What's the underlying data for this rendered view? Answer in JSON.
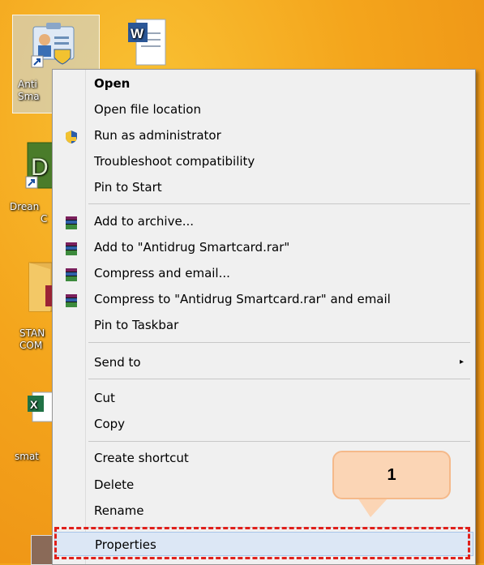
{
  "desktop": {
    "icons": [
      {
        "label_line1": "Anti",
        "label_line2": "Sma"
      },
      {
        "label_line1": "",
        "label_line2": ""
      },
      {
        "label_line1": "Drean",
        "label_line2": "C"
      },
      {
        "label_line1": "STAN",
        "label_line2": "COM"
      },
      {
        "label_line1": "smat",
        "label_line2": ""
      }
    ]
  },
  "menu": {
    "items": [
      {
        "label": "Open"
      },
      {
        "label": "Open file location"
      },
      {
        "label": "Run as administrator",
        "icon": "uac-shield-icon"
      },
      {
        "label": "Troubleshoot compatibility"
      },
      {
        "label": "Pin to Start"
      },
      {
        "label": "Add to archive...",
        "icon": "winrar-icon"
      },
      {
        "label": "Add to \"Antidrug Smartcard.rar\"",
        "icon": "winrar-icon"
      },
      {
        "label": "Compress and email...",
        "icon": "winrar-icon"
      },
      {
        "label": "Compress to \"Antidrug Smartcard.rar\" and email",
        "icon": "winrar-icon"
      },
      {
        "label": "Pin to Taskbar"
      },
      {
        "label": "Send to",
        "submenu_arrow": "▸"
      },
      {
        "label": "Cut"
      },
      {
        "label": "Copy"
      },
      {
        "label": "Create shortcut"
      },
      {
        "label": "Delete"
      },
      {
        "label": "Rename"
      },
      {
        "label": "Properties"
      }
    ]
  },
  "callout": {
    "text": "1"
  },
  "colors": {
    "highlight_border": "#e0201b",
    "callout_fill": "#fbd5b5",
    "desktop": "#f4a51c"
  }
}
